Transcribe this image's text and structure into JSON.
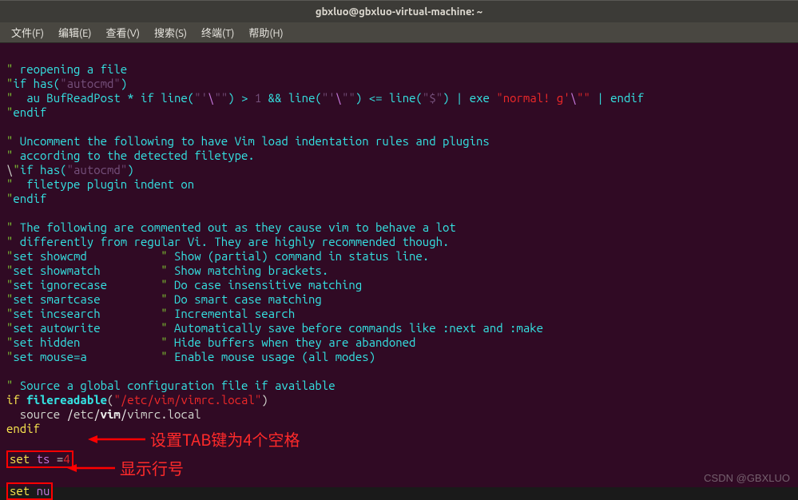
{
  "titlebar": {
    "title": "gbxluo@gbxluo-virtual-machine: ~"
  },
  "menu": {
    "file": "文件(F)",
    "edit": "编辑(E)",
    "view": "查看(V)",
    "search": "搜索(S)",
    "terminal": "终端(T)",
    "help": "帮助(H)"
  },
  "code": {
    "l01a": "\"",
    "l01b": " reopening a file",
    "l02a": "\"",
    "l02b": "if has(",
    "l02c": "\"autocmd\"",
    "l02d": ")",
    "l03a": "\"",
    "l03b": "  au BufReadPost * if line(",
    "l03c": "\"'",
    "l03d": "\\",
    "l03e": "\"\"",
    "l03f": ") > ",
    "l03g": "1",
    "l03h": " && line(",
    "l03i": "\"'",
    "l03j": "\\",
    "l03k": "\"\"",
    "l03l": ") <= line(",
    "l03m": "\"$\"",
    "l03n": ") | exe ",
    "l03o": "\"normal! g'",
    "l03p": "\\",
    "l03q": "\"\"",
    "l03r": " | endif",
    "l04a": "\"",
    "l04b": "endif",
    "l05": "",
    "l06a": "\"",
    "l06b": " Uncomment the following to have Vim load indentation rules and plugins",
    "l07a": "\"",
    "l07b": " according to the detected filetype.",
    "l08a": "\"",
    "l08b": "if has(",
    "l08c": "\"autocmd\"",
    "l08d": ")",
    "l09a": "\"",
    "l09b": "  filetype plugin indent on",
    "l10a": "\"",
    "l10b": "endif",
    "l11": "",
    "l12a": "\"",
    "l12b": " The following are commented out as they cause vim to behave a lot",
    "l13a": "\"",
    "l13b": " differently from regular Vi. They are highly recommended though.",
    "l14a": "\"",
    "l14b": "set showcmd           ",
    "l14c": "\"",
    "l14d": " Show (partial) command in status line.",
    "l15a": "\"",
    "l15b": "set showmatch         ",
    "l15c": "\"",
    "l15d": " Show matching brackets.",
    "l16a": "\"",
    "l16b": "set ignorecase        ",
    "l16c": "\"",
    "l16d": " Do case insensitive matching",
    "l17a": "\"",
    "l17b": "set smartcase         ",
    "l17c": "\"",
    "l17d": " Do smart case matching",
    "l18a": "\"",
    "l18b": "set incsearch         ",
    "l18c": "\"",
    "l18d": " Incremental search",
    "l19a": "\"",
    "l19b": "set autowrite         ",
    "l19c": "\"",
    "l19d": " Automatically save before commands like :next and :make",
    "l20a": "\"",
    "l20b": "set hidden            ",
    "l20c": "\"",
    "l20d": " Hide buffers when they are abandoned",
    "l21a": "\"",
    "l21b": "set mouse=a           ",
    "l21c": "\"",
    "l21d": " Enable mouse usage (all modes)",
    "l22": "",
    "l23a": "\"",
    "l23b": " Source a global configuration file if available",
    "l24a": "if",
    "l24b": " ",
    "l24c": "filereadable",
    "l24d": "(",
    "l24e": "\"/etc/vim/vimrc.local\"",
    "l24f": ")",
    "l25a": "  source ",
    "l25b": "/",
    "l25c": "etc",
    "l25d": "/",
    "l25e": "vim",
    "l25f": "/",
    "l25g": "vimrc",
    "l25h": ".local",
    "l26": "endif",
    "l27": "",
    "l28a": "set",
    "l28b": " ",
    "l28c": "ts",
    "l28d": " =",
    "l28e": "4",
    "l29": "",
    "l30a": "set",
    "l30b": " ",
    "l30c": "nu"
  },
  "annot": {
    "tab": "设置TAB键为4个空格",
    "nu": "显示行号"
  },
  "watermark": "CSDN @GBXLUO"
}
